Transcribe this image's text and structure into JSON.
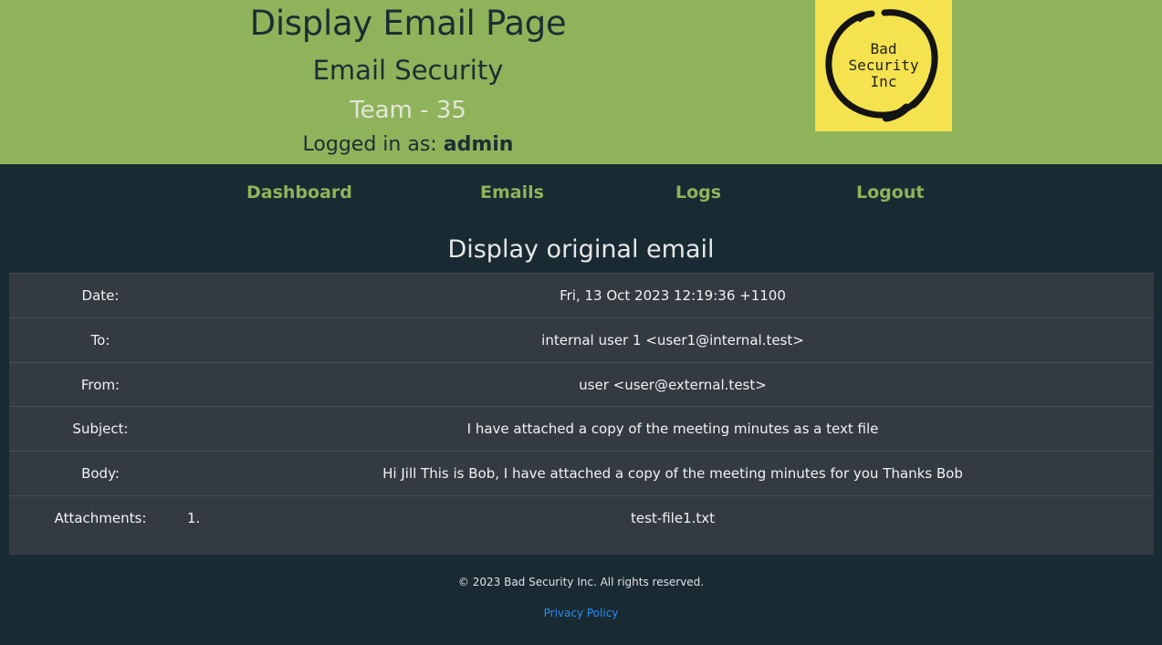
{
  "header": {
    "title": "Display Email Page",
    "subtitle": "Email Security",
    "team": "Team - 35",
    "logged_in_prefix": "Logged in as:",
    "username": "admin",
    "logo_text": "Bad\nSecurity\nInc",
    "logo_bg_color": "#f4e24e",
    "header_bg_color": "#8fb35b"
  },
  "nav": {
    "items": [
      {
        "label": "Dashboard"
      },
      {
        "label": "Emails"
      },
      {
        "label": "Logs"
      },
      {
        "label": "Logout"
      }
    ],
    "link_color": "#8fb35b"
  },
  "main": {
    "heading": "Display original email",
    "rows": [
      {
        "label": "Date:",
        "value": "Fri, 13 Oct 2023 12:19:36 +1100"
      },
      {
        "label": "To:",
        "value": "internal user 1 <user1@internal.test>"
      },
      {
        "label": "From:",
        "value": "user <user@external.test>"
      },
      {
        "label": "Subject:",
        "value": "I have attached a copy of the meeting minutes as a text file"
      },
      {
        "label": "Body:",
        "value": "Hi Jill This is Bob, I have attached a copy of the meeting minutes for you Thanks Bob"
      }
    ],
    "attachments": {
      "label": "Attachments:",
      "items": [
        {
          "number": "1.",
          "filename": "test-file1.txt"
        }
      ]
    }
  },
  "footer": {
    "copyright": "© 2023 Bad Security Inc. All rights reserved.",
    "privacy_link": "Privacy Policy"
  }
}
